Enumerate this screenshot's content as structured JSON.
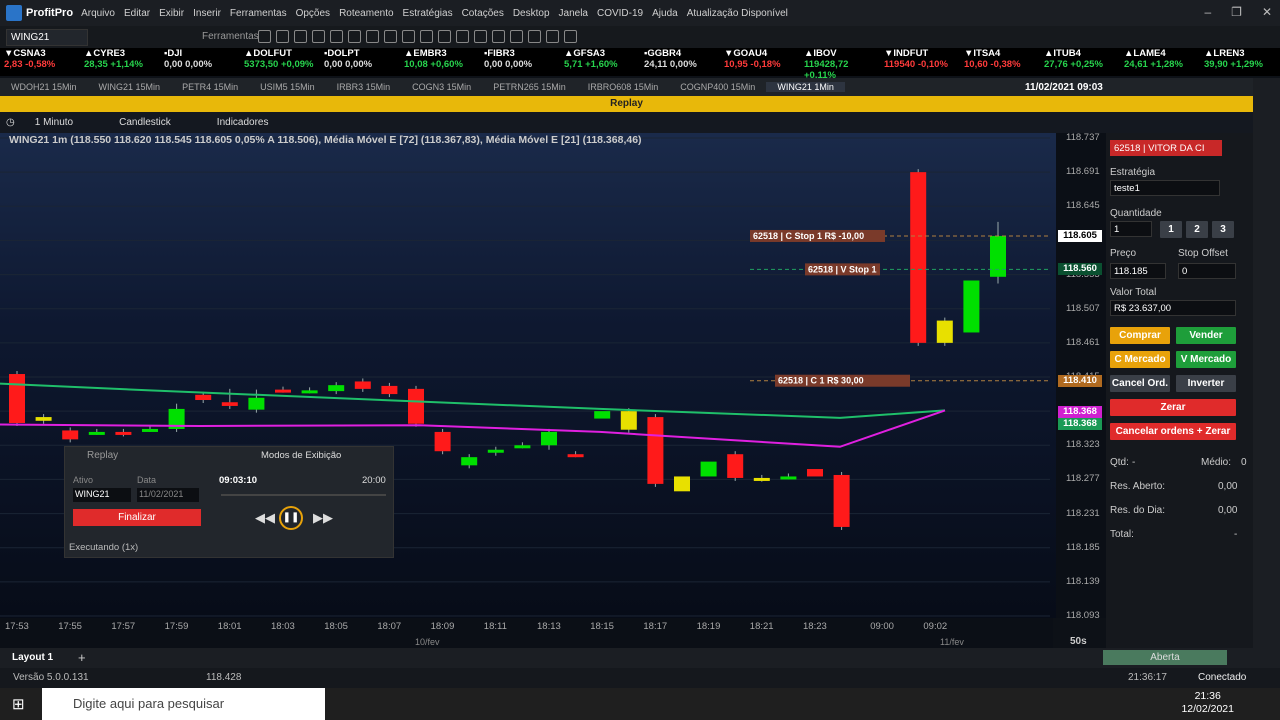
{
  "app": {
    "name": "ProfitPro",
    "menu": [
      "Arquivo",
      "Editar",
      "Exibir",
      "Inserir",
      "Ferramentas",
      "Opções",
      "Roteamento",
      "Estratégias",
      "Cotações",
      "Desktop",
      "Janela",
      "COVID-19",
      "Ajuda",
      "Atualização Disponível"
    ]
  },
  "toolbar": {
    "asset": "WING21",
    "ferramentas": "Ferramentas"
  },
  "ticker": [
    {
      "name": "CSNA3",
      "value": "2,83 -0,58%",
      "dir": "dn"
    },
    {
      "name": "CYRE3",
      "value": "28,35 +1,14%",
      "dir": "up"
    },
    {
      "name": "DJI",
      "value": "0,00 0,00%",
      "dir": "ne"
    },
    {
      "name": "DOLFUT",
      "value": "5373,50 +0,09%",
      "dir": "up"
    },
    {
      "name": "DOLPT",
      "value": "0,00 0,00%",
      "dir": "ne"
    },
    {
      "name": "EMBR3",
      "value": "10,08 +0,60%",
      "dir": "up"
    },
    {
      "name": "FIBR3",
      "value": "0,00 0,00%",
      "dir": "ne"
    },
    {
      "name": "GFSA3",
      "value": "5,71 +1,60%",
      "dir": "up"
    },
    {
      "name": "GGBR4",
      "value": "24,11 0,00%",
      "dir": "ne"
    },
    {
      "name": "GOAU4",
      "value": "10,95 -0,18%",
      "dir": "dn"
    },
    {
      "name": "IBOV",
      "value": "119428,72 +0,11%",
      "dir": "up"
    },
    {
      "name": "INDFUT",
      "value": "119540 -0,10%",
      "dir": "dn"
    },
    {
      "name": "ITSA4",
      "value": "10,60 -0,38%",
      "dir": "dn"
    },
    {
      "name": "ITUB4",
      "value": "27,76 +0,25%",
      "dir": "up"
    },
    {
      "name": "LAME4",
      "value": "24,61 +1,28%",
      "dir": "up"
    },
    {
      "name": "LREN3",
      "value": "39,90 +1,29%",
      "dir": "up"
    }
  ],
  "tabs": [
    "WDOH21 15Min",
    "WING21 15Min",
    "PETR4 15Min",
    "USIM5 15Min",
    "IRBR3 15Min",
    "COGN3 15Min",
    "PETRN265 15Min",
    "IRBRO608 15Min",
    "COGNP400 15Min",
    "WING21 1Min"
  ],
  "tab_date": "11/02/2021 09:03",
  "replay_title": "Replay",
  "chart_tools": {
    "interval": "1 Minuto",
    "type": "Candlestick",
    "indicators": "Indicadores"
  },
  "legend": "WING21 1m (118.550  118.620  118.545  118.605  0,05%  A 118.506), Média Móvel E [72] (118.367,83), Média Móvel E [21] (118.368,46)",
  "chart_data": {
    "type": "candlestick",
    "yticks": [
      "118.737",
      "118.691",
      "118.645",
      "118.599",
      "118.553",
      "118.507",
      "118.461",
      "118.415",
      "118.369",
      "118.323",
      "118.277",
      "118.231",
      "118.185",
      "118.139",
      "118.093"
    ],
    "xticks": [
      "17:53",
      "17:55",
      "17:57",
      "17:59",
      "18:01",
      "18:03",
      "18:05",
      "18:07",
      "18:09",
      "18:11",
      "18:13",
      "18:15",
      "18:17",
      "18:19",
      "18:21",
      "18:23",
      "09:00",
      "09:02"
    ],
    "dates": [
      "10/fev",
      "11/fev"
    ],
    "ylim": [
      118.093,
      118.737
    ],
    "candles": [
      [
        118.419,
        118.419,
        118.353,
        118.353,
        "dn"
      ],
      [
        118.361,
        118.361,
        118.356,
        118.356,
        "ye"
      ],
      [
        118.343,
        118.343,
        118.331,
        118.331,
        "dn"
      ],
      [
        118.341,
        118.341,
        118.341,
        118.341,
        "up"
      ],
      [
        118.341,
        118.341,
        118.339,
        118.339,
        "dn"
      ],
      [
        118.345,
        118.345,
        118.345,
        118.345,
        "up"
      ],
      [
        118.345,
        118.375,
        118.345,
        118.372,
        "up"
      ],
      [
        118.391,
        118.391,
        118.384,
        118.384,
        "dn"
      ],
      [
        118.381,
        118.395,
        118.376,
        118.376,
        "dn"
      ],
      [
        118.371,
        118.394,
        118.371,
        118.387,
        "up"
      ],
      [
        118.398,
        118.398,
        118.398,
        118.398,
        "dn"
      ],
      [
        118.397,
        118.397,
        118.397,
        118.397,
        "up"
      ],
      [
        118.404,
        118.404,
        118.396,
        118.396,
        "up"
      ],
      [
        118.409,
        118.409,
        118.399,
        118.399,
        "dn"
      ],
      [
        118.403,
        118.403,
        118.392,
        118.392,
        "dn"
      ],
      [
        118.399,
        118.399,
        118.352,
        118.352,
        "dn"
      ],
      [
        118.341,
        118.341,
        118.315,
        118.315,
        "dn"
      ],
      [
        118.307,
        118.307,
        118.296,
        118.296,
        "up"
      ],
      [
        118.317,
        118.317,
        118.313,
        118.313,
        "up"
      ],
      [
        118.323,
        118.323,
        118.323,
        118.323,
        "up"
      ],
      [
        118.341,
        118.341,
        118.321,
        118.323,
        "up"
      ],
      [
        118.311,
        118.311,
        118.311,
        118.311,
        "dn"
      ],
      [
        118.359,
        118.359,
        118.369,
        118.369,
        "up"
      ],
      [
        118.369,
        118.369,
        118.344,
        118.344,
        "ye"
      ],
      [
        118.361,
        118.361,
        118.271,
        118.271,
        "dn"
      ],
      [
        118.261,
        118.261,
        118.281,
        118.281,
        "ye"
      ],
      [
        118.281,
        118.281,
        118.301,
        118.301,
        "up"
      ],
      [
        118.311,
        118.311,
        118.279,
        118.279,
        "dn"
      ],
      [
        118.279,
        118.279,
        118.278,
        118.278,
        "ye"
      ],
      [
        118.281,
        118.281,
        118.281,
        118.281,
        "up"
      ],
      [
        118.281,
        118.281,
        118.291,
        118.291,
        "dn"
      ],
      [
        118.283,
        118.283,
        118.213,
        118.213,
        "dn"
      ],
      [
        118.691,
        118.691,
        118.461,
        118.461,
        "dn"
      ],
      [
        118.491,
        118.491,
        118.461,
        118.461,
        "ye"
      ],
      [
        118.475,
        118.475,
        118.545,
        118.545,
        "up"
      ],
      [
        118.55,
        118.62,
        118.545,
        118.605,
        "up"
      ]
    ],
    "ema72_label": "Média Móvel E [72]",
    "ema21_label": "Média Móvel E [21]",
    "orders": [
      {
        "label": "62518 | C Stop 1",
        "pl": "R$ -10,00"
      },
      {
        "label": "62518 | V Stop 1"
      },
      {
        "label": "62518 | C 1",
        "pl": "R$ 30,00"
      }
    ],
    "price_tags": [
      "118.605",
      "118.560",
      "118.410",
      "118.368",
      "118.368"
    ]
  },
  "right_panel": {
    "account": "62518 | VITOR DA CI",
    "estrategia_label": "Estratégia",
    "estrategia": "teste1",
    "quantidade_label": "Quantidade",
    "quantidade": "1",
    "q_buttons": [
      "1",
      "2",
      "3"
    ],
    "preco_label": "Preço",
    "preco": "118.185",
    "stop_label": "Stop Offset",
    "stop": "0",
    "valor_label": "Valor Total",
    "valor": "R$ 23.637,00",
    "buttons": {
      "comprar": "Comprar",
      "vender": "Vender",
      "c_mercado": "C Mercado",
      "v_mercado": "V Mercado",
      "cancel": "Cancel Ord.",
      "inverter": "Inverter",
      "zerar": "Zerar",
      "cancelar_zerar": "Cancelar ordens + Zerar"
    },
    "qtd_label": "Qtd:",
    "qtd": "-",
    "medio_label": "Médio:",
    "medio": "0",
    "res_aberto_label": "Res. Aberto:",
    "res_aberto": "0,00",
    "res_dia_label": "Res. do Dia:",
    "res_dia": "0,00",
    "total_label": "Total:",
    "total": "-"
  },
  "replay": {
    "title": "Replay",
    "modos": "Modos de Exibição",
    "ativo_label": "Ativo",
    "data_label": "Data",
    "ativo": "WING21",
    "data": "11/02/2021",
    "time": "09:03:10",
    "end": "20:00",
    "finalizar": "Finalizar",
    "executando": "Executando (1x)"
  },
  "bottom": {
    "layout": "Layout 1",
    "status": "Aberta",
    "timer": "50s"
  },
  "status": {
    "version": "Versão 5.0.0.131",
    "price": "118.428",
    "time": "21:36:17",
    "conn": "Conectado"
  },
  "taskbar": {
    "search": "Digite aqui para pesquisar",
    "time": "21:36",
    "date": "12/02/2021"
  }
}
